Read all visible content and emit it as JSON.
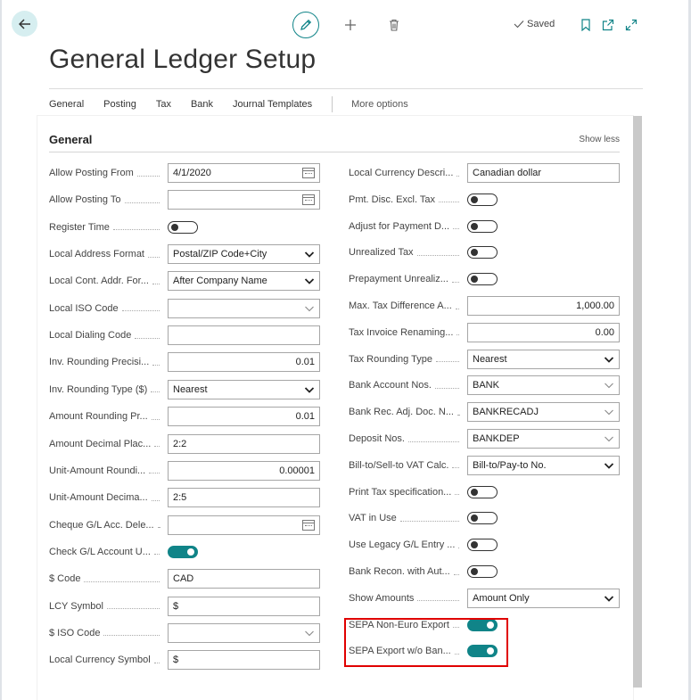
{
  "header": {
    "saved_label": "Saved",
    "title": "General Ledger Setup"
  },
  "tabs": {
    "items": [
      "General",
      "Posting",
      "Tax",
      "Bank",
      "Journal Templates"
    ],
    "more": "More options"
  },
  "section": {
    "title": "General",
    "toggle_label": "Show less"
  },
  "left_fields": [
    {
      "label": "Allow Posting From",
      "type": "date",
      "value": "4/1/2020"
    },
    {
      "label": "Allow Posting To",
      "type": "date",
      "value": ""
    },
    {
      "label": "Register Time",
      "type": "toggle",
      "on": false
    },
    {
      "label": "Local Address Format",
      "type": "select",
      "value": "Postal/ZIP Code+City"
    },
    {
      "label": "Local Cont. Addr. For...",
      "type": "select",
      "value": "After Company Name"
    },
    {
      "label": "Local ISO Code",
      "type": "lookup",
      "value": ""
    },
    {
      "label": "Local Dialing Code",
      "type": "text",
      "value": ""
    },
    {
      "label": "Inv. Rounding Precisi...",
      "type": "number",
      "value": "0.01"
    },
    {
      "label": "Inv. Rounding Type ($)",
      "type": "select",
      "value": "Nearest"
    },
    {
      "label": "Amount Rounding Pr...",
      "type": "number",
      "value": "0.01"
    },
    {
      "label": "Amount Decimal Plac...",
      "type": "text",
      "value": "2:2"
    },
    {
      "label": "Unit-Amount Roundi...",
      "type": "number",
      "value": "0.00001"
    },
    {
      "label": "Unit-Amount Decima...",
      "type": "text",
      "value": "2:5"
    },
    {
      "label": "Cheque G/L Acc. Dele...",
      "type": "date",
      "value": ""
    },
    {
      "label": "Check G/L Account U...",
      "type": "toggle",
      "on": true
    },
    {
      "label": "$ Code",
      "type": "text",
      "value": "CAD"
    },
    {
      "label": "LCY Symbol",
      "type": "text",
      "value": "$"
    },
    {
      "label": "$ ISO Code",
      "type": "lookup",
      "value": ""
    },
    {
      "label": "Local Currency Symbol",
      "type": "text",
      "value": "$"
    }
  ],
  "right_fields": [
    {
      "label": "Local Currency Descri...",
      "type": "text",
      "value": "Canadian dollar"
    },
    {
      "label": "Pmt. Disc. Excl. Tax",
      "type": "toggle",
      "on": false
    },
    {
      "label": "Adjust for Payment D...",
      "type": "toggle",
      "on": false
    },
    {
      "label": "Unrealized Tax",
      "type": "toggle",
      "on": false
    },
    {
      "label": "Prepayment Unrealiz...",
      "type": "toggle",
      "on": false
    },
    {
      "label": "Max. Tax Difference A...",
      "type": "number",
      "value": "1,000.00"
    },
    {
      "label": "Tax Invoice Renaming...",
      "type": "number",
      "value": "0.00"
    },
    {
      "label": "Tax Rounding Type",
      "type": "select",
      "value": "Nearest"
    },
    {
      "label": "Bank Account Nos.",
      "type": "lookup",
      "value": "BANK"
    },
    {
      "label": "Bank Rec. Adj. Doc. N...",
      "type": "lookup",
      "value": "BANKRECADJ"
    },
    {
      "label": "Deposit Nos.",
      "type": "lookup",
      "value": "BANKDEP"
    },
    {
      "label": "Bill-to/Sell-to VAT Calc.",
      "type": "select",
      "value": "Bill-to/Pay-to No."
    },
    {
      "label": "Print Tax specification...",
      "type": "toggle",
      "on": false
    },
    {
      "label": "VAT in Use",
      "type": "toggle",
      "on": false
    },
    {
      "label": "Use Legacy G/L Entry ...",
      "type": "toggle",
      "on": false
    },
    {
      "label": "Bank Recon. with Aut...",
      "type": "toggle",
      "on": false
    },
    {
      "label": "Show Amounts",
      "type": "select",
      "value": "Amount Only"
    },
    {
      "label": "SEPA Non-Euro Export",
      "type": "toggle",
      "on": true
    },
    {
      "label": "SEPA Export w/o Ban...",
      "type": "toggle",
      "on": true
    }
  ],
  "colors": {
    "accent": "#108488",
    "highlight": "#e00000"
  }
}
